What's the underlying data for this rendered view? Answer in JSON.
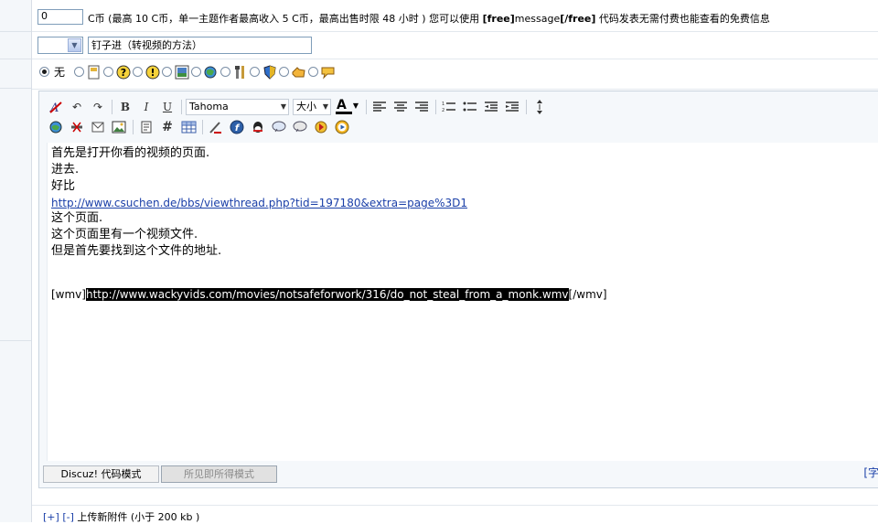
{
  "price": {
    "value": "0",
    "note": "C币 (最高 10 C币，单一主题作者最高收入 5 C币，最高出售时限 48 小时 ) 您可以使用 ",
    "tag_open": "[free]",
    "tag_mid": "message",
    "tag_close": "[/free]",
    "note_end": " 代码发表无需付费也能查看的免费信息"
  },
  "subject": {
    "value": "钉子进（转视频的方法）"
  },
  "post_icons": {
    "none_label": "无",
    "icons": [
      "doc-icon",
      "question-icon",
      "exclamation-icon",
      "picture-icon",
      "globe-icon",
      "tools-icon",
      "shield-icon",
      "thumb-icon",
      "comment-icon"
    ]
  },
  "toolbar": {
    "font_name": "Tahoma",
    "font_size": "大小",
    "color_accent": "#c00000"
  },
  "editor": {
    "lines": [
      "首先是打开你看的视频的页面.",
      "进去.",
      "好比",
      "这个页面.",
      "这个页面里有一个视频文件.",
      "但是首先要找到这个文件的地址."
    ],
    "link": "http://www.csuchen.de/bbs/viewthread.php?tid=197180&extra=page%3D1",
    "wmv_open": "[wmv]",
    "wmv_url": "http://www.wackyvids.com/movies/notsafeforwork/316/do_not_steal_from_a_monk.wmv",
    "wmv_close": "[/wmv]"
  },
  "modes": {
    "code": "Discuz! 代码模式",
    "wysiwyg": "所见即所得模式"
  },
  "word_count": "[字",
  "attach": {
    "expand": "[+]",
    "collapse": "[-]",
    "label": " 上传新附件 (小于 200 kb )"
  }
}
